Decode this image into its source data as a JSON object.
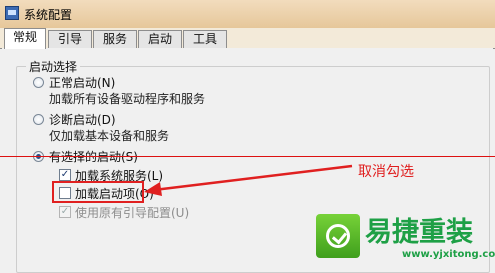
{
  "window": {
    "title": "系统配置"
  },
  "tabs": [
    {
      "label": "常规",
      "active": true
    },
    {
      "label": "引导",
      "active": false
    },
    {
      "label": "服务",
      "active": false
    },
    {
      "label": "启动",
      "active": false
    },
    {
      "label": "工具",
      "active": false
    }
  ],
  "startup_group": {
    "legend": "启动选择",
    "options": [
      {
        "label": "正常启动(N)",
        "description": "加载所有设备驱动程序和服务",
        "selected": false
      },
      {
        "label": "诊断启动(D)",
        "description": "仅加载基本设备和服务",
        "selected": false
      },
      {
        "label": "有选择的启动(S)",
        "selected": true
      }
    ],
    "checkboxes": [
      {
        "label": "加载系统服务(L)",
        "checked": true,
        "enabled": true
      },
      {
        "label": "加载启动项(O)",
        "checked": false,
        "enabled": true
      },
      {
        "label": "使用原有引导配置(U)",
        "checked": true,
        "enabled": false
      }
    ]
  },
  "annotation": {
    "text": "取消勾选",
    "color": "#e02020"
  },
  "watermark": {
    "brand": "易捷重装",
    "url": "www.yjxitong.com",
    "color": "#1ea046"
  }
}
